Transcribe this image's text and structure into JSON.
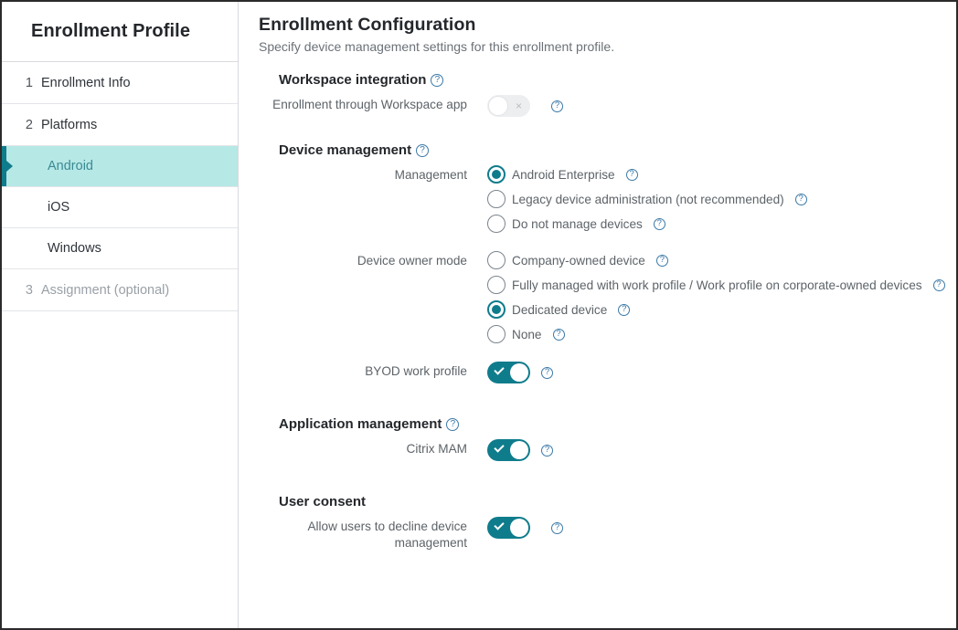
{
  "sidebar": {
    "title": "Enrollment Profile",
    "steps": [
      {
        "num": "1",
        "label": "Enrollment Info",
        "disabled": false
      },
      {
        "num": "2",
        "label": "Platforms",
        "disabled": false
      }
    ],
    "platforms": [
      {
        "label": "Android",
        "active": true
      },
      {
        "label": "iOS",
        "active": false
      },
      {
        "label": "Windows",
        "active": false
      }
    ],
    "final_step": {
      "num": "3",
      "label": "Assignment (optional)",
      "disabled": true
    }
  },
  "main": {
    "title": "Enrollment Configuration",
    "subtitle": "Specify device management settings for this enrollment profile.",
    "sections": {
      "workspace_integration": {
        "heading": "Workspace integration",
        "help": "?",
        "field_label": "Enrollment through Workspace app",
        "toggle_state": "off"
      },
      "device_management": {
        "heading": "Device management",
        "help": "?",
        "management": {
          "label": "Management",
          "options": [
            {
              "label": "Android Enterprise",
              "checked": true
            },
            {
              "label": "Legacy device administration (not recommended)",
              "checked": false
            },
            {
              "label": "Do not manage devices",
              "checked": false
            }
          ]
        },
        "device_owner_mode": {
          "label": "Device owner mode",
          "options": [
            {
              "label": "Company-owned device",
              "checked": false
            },
            {
              "label": "Fully managed with work profile / Work profile on corporate-owned devices",
              "checked": false
            },
            {
              "label": "Dedicated device",
              "checked": true
            },
            {
              "label": "None",
              "checked": false
            }
          ]
        },
        "byod": {
          "label": "BYOD work profile",
          "toggle_state": "on"
        }
      },
      "application_management": {
        "heading": "Application management",
        "help": "?",
        "citrix_mam": {
          "label": "Citrix MAM",
          "toggle_state": "on"
        }
      },
      "user_consent": {
        "heading": "User consent",
        "decline": {
          "label": "Allow users to decline device management",
          "toggle_state": "on"
        }
      }
    }
  },
  "icons": {
    "help": "?"
  },
  "colors": {
    "accent_teal": "#0f7c8c",
    "active_row_bg": "#b6e8e6",
    "help_blue": "#3b79a8",
    "toggle_off_track": "#eceef0"
  }
}
